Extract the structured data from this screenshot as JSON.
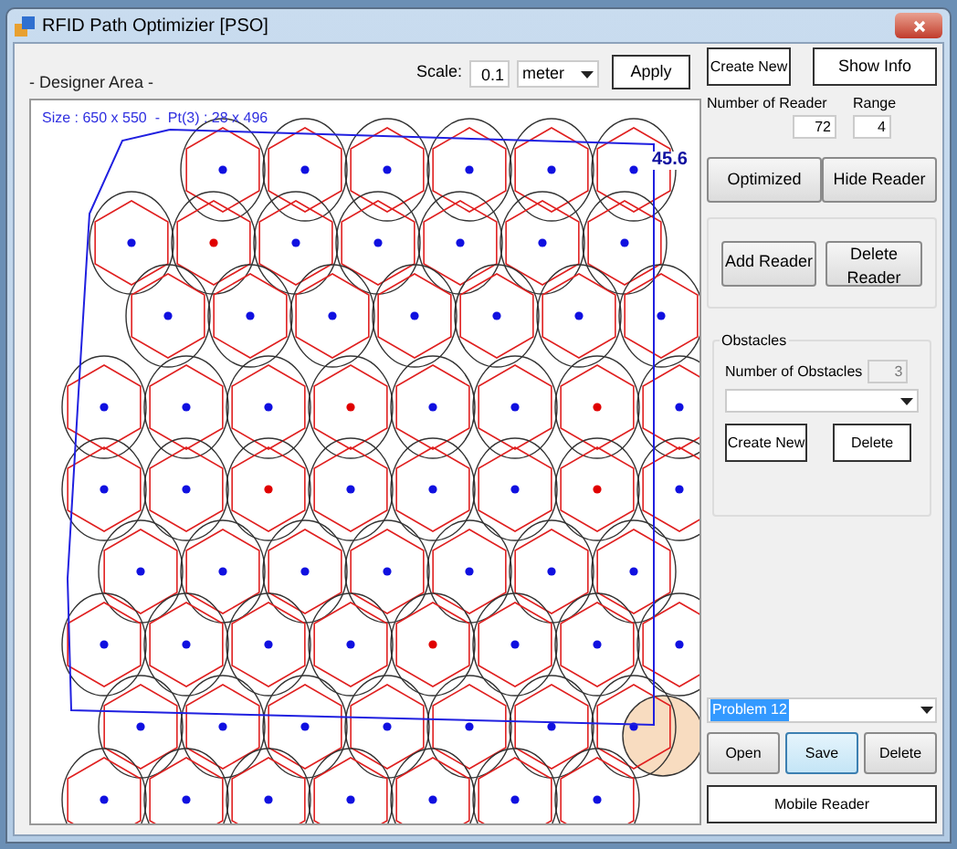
{
  "window": {
    "title": "RFID Path Optimizier [PSO]"
  },
  "designer": {
    "label": "- Designer Area -",
    "scale_label": "Scale:",
    "scale_value": "0.1",
    "unit": "meter",
    "apply": "Apply",
    "size_text": "Size : 650 x 550  -  Pt(3) : 28 x 496",
    "distance": "45.6"
  },
  "top_buttons": [
    "Create New",
    "Show Info"
  ],
  "readers": {
    "count_label": "Number of Reader",
    "count": "72",
    "range_label": "Range",
    "range": "4"
  },
  "reader_buttons": [
    "Optimized",
    "Hide Reader"
  ],
  "edit_buttons": [
    "Add Reader",
    "Delete Reader"
  ],
  "obstacles": {
    "title": "Obstacles",
    "count_label": "Number of Obstacles",
    "count": "3",
    "buttons": [
      "Create New",
      "Delete"
    ]
  },
  "problem": {
    "value": "Problem 12"
  },
  "file_buttons": [
    {
      "label": "Open",
      "selected": false
    },
    {
      "label": "Save",
      "selected": true
    },
    {
      "label": "Delete",
      "selected": false
    }
  ],
  "mobile_button": "Mobile Reader"
}
